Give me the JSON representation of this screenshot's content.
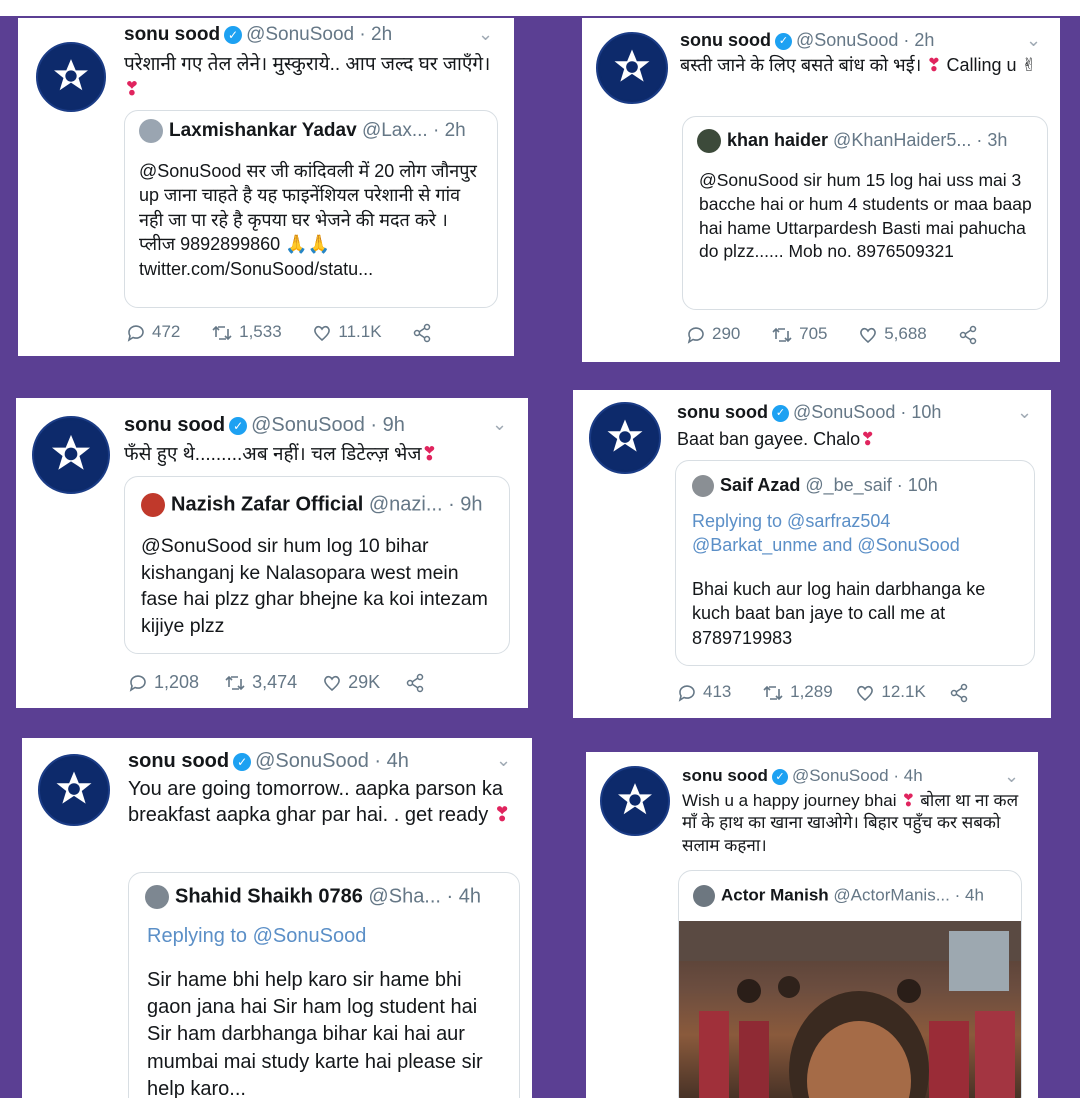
{
  "colors": {
    "background": "#5b3f93",
    "verified": "#1da1f2",
    "heart": "#e0245e",
    "reply_link": "#5b8fc7",
    "muted": "#657786"
  },
  "author": {
    "name": "sonu sood",
    "handle": "@SonuSood",
    "avatar_icon": "police-badge-icon"
  },
  "tweets": [
    {
      "time": "· 2h",
      "text": "परेशानी गए तेल लेने। मुस्कुराये.. आप जल्द घर जाएँगे। ❣",
      "quote": {
        "name": "Laxmishankar Yadav",
        "handle": "@Lax...",
        "time": "· 2h",
        "body": "@SonuSood सर जी कांदिवली में 20 लोग जौनपुर up जाना चाहते है यह फाइनेंशियल परेशानी से गांव नही जा पा रहे है कृपया घर भेजने की मदत करे । प्लीज 9892899860 🙏🙏 twitter.com/SonuSood/statu..."
      },
      "replies": "472",
      "retweets": "1,533",
      "likes": "11.1K"
    },
    {
      "time": "· 2h",
      "text": "बस्ती जाने के लिए बसते बांध को भई। ❣ Calling u ✌",
      "quote": {
        "name": "khan haider",
        "handle": "@KhanHaider5...",
        "time": "· 3h",
        "body": "@SonuSood sir hum 15 log hai uss mai 3 bacche hai or hum 4 students or maa baap hai hame Uttarpardesh Basti mai pahucha do plzz...... Mob no. 8976509321"
      },
      "replies": "290",
      "retweets": "705",
      "likes": "5,688"
    },
    {
      "time": "· 9h",
      "text": "फँसे हुए थे.........अब नहीं। चल डिटेल्ज़ भेज❣",
      "quote": {
        "name": "Nazish Zafar Official",
        "handle": "@nazi...",
        "time": "· 9h",
        "body": "@SonuSood  sir hum log 10 bihar kishanganj ke Nalasopara west mein fase hai plzz ghar bhejne ka koi intezam kijiye plzz"
      },
      "replies": "1,208",
      "retweets": "3,474",
      "likes": "29K"
    },
    {
      "time": "· 10h",
      "text": "Baat ban gayee. Chalo❣",
      "quote": {
        "name": "Saif Azad",
        "handle": "@_be_saif",
        "time": "· 10h",
        "replying": "Replying to @sarfraz504 @Barkat_unme and @SonuSood",
        "body": "Bhai kuch aur log hain darbhanga ke kuch baat ban jaye to call me at 8789719983"
      },
      "replies": "413",
      "retweets": "1,289",
      "likes": "12.1K"
    },
    {
      "time": "· 4h",
      "text": "You are going tomorrow.. aapka parson ka breakfast aapka ghar par hai. . get ready ❣",
      "quote": {
        "name": "Shahid Shaikh 0786",
        "handle": "@Sha...",
        "time": "· 4h",
        "replying": "Replying to @SonuSood",
        "body": "Sir hame bhi help karo sir hame bhi gaon jana hai Sir ham log student hai Sir ham darbhanga bihar kai hai aur mumbai mai study karte hai please sir help karo..."
      }
    },
    {
      "time": "· 4h",
      "text": "Wish u a happy journey bhai ❣ बोला था ना कल माँ के हाथ का खाना खाओगे। बिहार पहुँच कर सबको सलाम कहना।",
      "quote": {
        "name": "Actor Manish",
        "handle": "@ActorManis...",
        "time": "· 4h"
      }
    }
  ]
}
